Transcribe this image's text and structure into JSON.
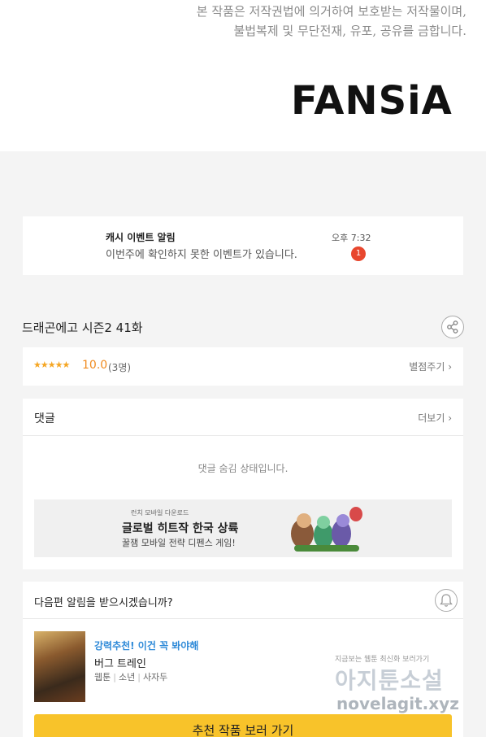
{
  "copyright": {
    "line1": "본 작품은 저작권법에 의거하여 보호받는 저작물이며,",
    "line2": "불법복제 및 무단전재, 유포, 공유를 금합니다."
  },
  "brand": {
    "logo_text": "FANSiA"
  },
  "notification": {
    "title": "캐시 이벤트 알림",
    "message": "이번주에 확인하지 못한 이벤트가 있습니다.",
    "time": "오후 7:32",
    "badge_count": "1"
  },
  "episode": {
    "title": "드래곤에고 시즌2 41화",
    "share_icon": "share-icon"
  },
  "rating": {
    "stars": "★★★★★",
    "score": "10.0",
    "count": "(3명)",
    "rate_button": "별점주기 ›"
  },
  "comments": {
    "title": "댓글",
    "more": "더보기 ›",
    "hidden_message": "댓글 숨김 상태입니다."
  },
  "ad": {
    "small_label": "런치 모바일 다운로드",
    "title": "글로벌 히트작 한국 상륙",
    "subtitle": "꿀잼 모바일 전략 디펜스 게임!"
  },
  "next_episode": {
    "question": "다음편 알림을 받으시겠습니까?",
    "bell_icon": "bell-icon"
  },
  "recommendation": {
    "tag": "강력추천! 이건 꼭 봐야해",
    "title": "버그 트레인",
    "meta": [
      "웹툰",
      "소년",
      "사자두"
    ],
    "button": "추천 작품 보러 가기"
  },
  "watermark": {
    "line1": "지금보는 웹툰 최신화 보러가기",
    "line2": "아지툰소설",
    "line3": "novelagit.xyz"
  },
  "colors": {
    "accent_yellow": "#f8c32a",
    "badge_red": "#e8472e",
    "score_orange": "#f08a1e",
    "link_blue": "#2f8ad8"
  }
}
